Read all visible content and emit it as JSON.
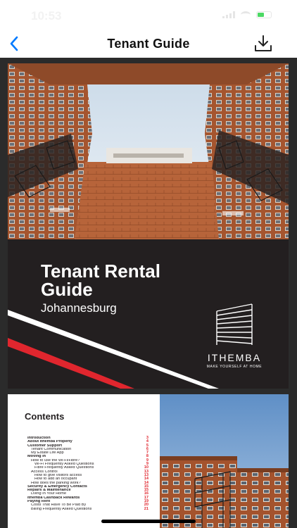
{
  "status_bar": {
    "time": "10:53"
  },
  "nav": {
    "title": "Tenant Guide"
  },
  "cover": {
    "title": "Tenant Rental Guide",
    "subtitle": "Johannesburg",
    "logo_name": "ITHEMBA",
    "logo_tagline": "MAKE YOURSELF AT HOME"
  },
  "contents": {
    "title": "Contents",
    "items": [
      {
        "label": "Introduction",
        "page": "3",
        "level": 0
      },
      {
        "label": "About Ithemba Property",
        "page": "4",
        "level": 0
      },
      {
        "label": "Customer Support",
        "page": "5",
        "level": 0
      },
      {
        "label": "Tenant Communication",
        "page": "6",
        "level": 1
      },
      {
        "label": "My Estate Life App",
        "page": "7",
        "level": 1
      },
      {
        "label": "Moving In",
        "page": "8",
        "level": 0
      },
      {
        "label": "How to use the Wi-Fi/Fibre?",
        "page": "9",
        "level": 1
      },
      {
        "label": "Wi-Fi Frequently Asked Questions",
        "page": "9",
        "level": 2
      },
      {
        "label": "Fibre Frequently Asked Questions",
        "page": "10",
        "level": 2
      },
      {
        "label": "Access Control",
        "page": "13",
        "level": 1
      },
      {
        "label": "How to give visitors access",
        "page": "13",
        "level": 2
      },
      {
        "label": "How to add an occupant",
        "page": "14",
        "level": 2
      },
      {
        "label": "How does the parking work?",
        "page": "14",
        "level": 1
      },
      {
        "label": "Security & Emergency Contacts",
        "page": "15",
        "level": 0
      },
      {
        "label": "Repairs & Maintenance",
        "page": "15",
        "level": 0
      },
      {
        "label": "Living In Your Home",
        "page": "16",
        "level": 1
      },
      {
        "label": "Ithemba Cashback Rewards",
        "page": "17",
        "level": 0
      },
      {
        "label": "Paying Rent",
        "page": "19",
        "level": 0
      },
      {
        "label": "Costs That Have To Be Paid By",
        "page": "20",
        "level": 1
      },
      {
        "label": "Billing Frequently Asked Questions",
        "page": "21",
        "level": 1
      }
    ]
  },
  "colors": {
    "accent": "#007aff",
    "brand_red": "#e0262e",
    "cover_bg": "#231f20"
  },
  "icons": {
    "back": "chevron-left-icon",
    "download": "download-icon"
  }
}
